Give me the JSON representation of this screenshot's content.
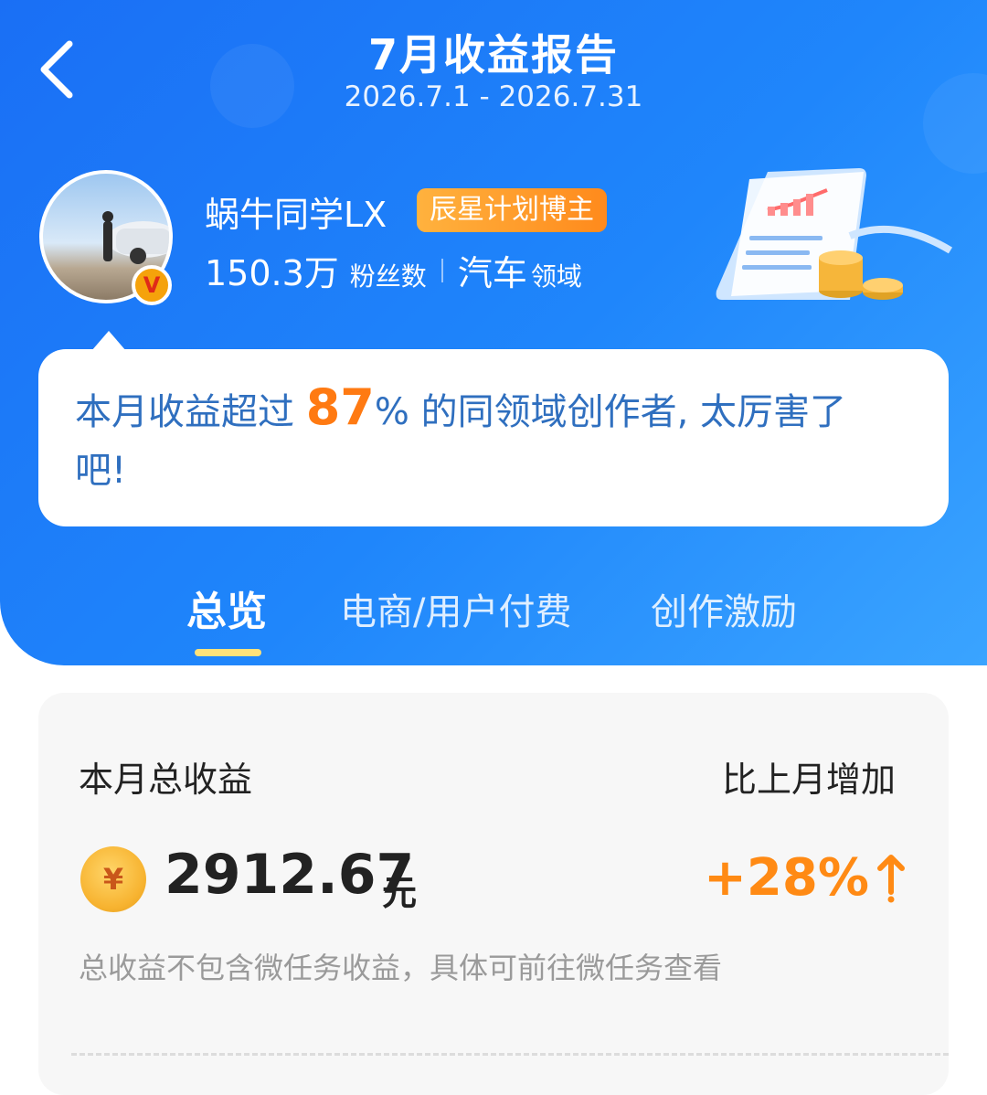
{
  "header": {
    "title": "7月收益报告",
    "date_range": "2026.7.1 - 2026.7.31"
  },
  "profile": {
    "username": "蜗牛同学LX",
    "badge": "辰星计划博主",
    "followers": "150.3万",
    "followers_label": "粉丝数",
    "field": "汽车",
    "field_label": "领域",
    "verified_mark": "V"
  },
  "bubble": {
    "prefix": "本月收益超过",
    "percent": "87",
    "percent_sign": "%",
    "suffix": "的同领域创作者, 太厉害了吧!"
  },
  "tabs": [
    {
      "label": "总览",
      "active": true
    },
    {
      "label": "电商/用户付费",
      "active": false
    },
    {
      "label": "创作激励",
      "active": false
    }
  ],
  "summary": {
    "total_label": "本月总收益",
    "compare_label": "比上月增加",
    "currency_symbol": "¥",
    "amount": "2912.67",
    "unit": "元",
    "increase": "+28%",
    "note": "总收益不包含微任务收益，具体可前往微任务查看"
  },
  "colors": {
    "primary": "#1f7ef8",
    "accent": "#ff8a14",
    "badge": "#ff9a2a",
    "bubble_text": "#2f6fbf"
  }
}
